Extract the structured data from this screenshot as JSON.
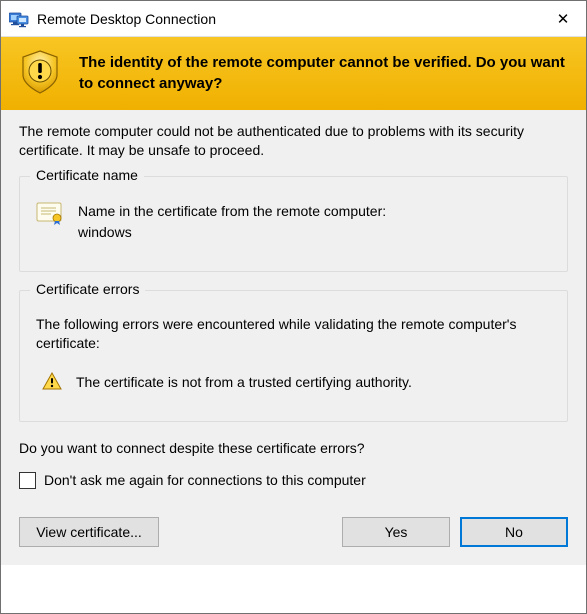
{
  "titlebar": {
    "title": "Remote Desktop Connection",
    "close_icon": "✕"
  },
  "banner": {
    "text": "The identity of the remote computer cannot be verified. Do you want to connect anyway?"
  },
  "lead": "The remote computer could not be authenticated due to problems with its security certificate. It may be unsafe to proceed.",
  "cert_group": {
    "title": "Certificate name",
    "name_label": "Name in the certificate from the remote computer:",
    "name_value": "windows"
  },
  "err_group": {
    "title": "Certificate errors",
    "intro": "The following errors were encountered while validating the remote computer's certificate:",
    "item": "The certificate is not from a trusted certifying authority."
  },
  "question": "Do you want to connect despite these certificate errors?",
  "checkbox_label": "Don't ask me again for connections to this computer",
  "buttons": {
    "view_cert": "View certificate...",
    "yes": "Yes",
    "no": "No"
  }
}
